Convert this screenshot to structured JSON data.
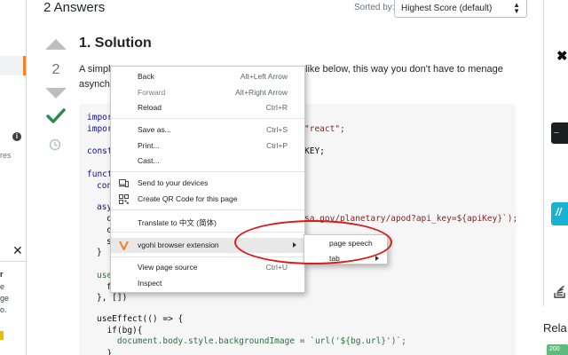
{
  "header": {
    "answers_count": "2 Answers",
    "sort_label": "Sorted by:",
    "sort_value": "Highest Score (default)"
  },
  "vote": {
    "count": "2"
  },
  "answer": {
    "title": "1. Solution",
    "p1": "A simpl",
    "p2": "like below, this way you don't have to menage",
    "p3": "asynchr",
    "code": [
      {
        "text": "impor",
        "kind": "kw"
      },
      {
        "text": "impor",
        "kind": "kw"
      },
      {
        "text": "\"react\";",
        "kind": "str"
      },
      {
        "text": "const",
        "kind": "kw"
      },
      {
        "text": "KEY;",
        "kind": "plain"
      },
      {
        "text": "funct",
        "kind": "kw"
      },
      {
        "text": "con",
        "kind": "kw"
      },
      {
        "text": "asy",
        "kind": "kw"
      },
      {
        "text": "c",
        "kind": "plain"
      },
      {
        "text": "sa.gov/planetary/apod?api_key=${apiKey}`);",
        "kind": "str"
      },
      {
        "text": "c",
        "kind": "plain"
      },
      {
        "text": "s",
        "kind": "plain"
      },
      {
        "text": "}",
        "kind": "plain"
      },
      {
        "text": "use",
        "kind": "fn"
      },
      {
        "text": "f",
        "kind": "plain"
      },
      {
        "text": "}, [])",
        "kind": "plain"
      },
      {
        "text": "useEffect(() => {",
        "kind": "plain"
      },
      {
        "text": "  if(bg){",
        "kind": "plain"
      },
      {
        "text": "    document.body.style.backgroundImage = `url('${bg.url}')`;",
        "kind": "plain"
      },
      {
        "text": "  }",
        "kind": "plain"
      }
    ]
  },
  "left_gutter": {
    "info": "i",
    "res": "res",
    "close": "✕",
    "r": "r",
    "e": "e",
    "ge": "ge",
    "o": "o."
  },
  "right_sidebar": {
    "x": "✖",
    "dark_text": "-----",
    "cyan_text": "//",
    "related": "Rela",
    "badge": "200"
  },
  "context_menu": {
    "items": [
      {
        "label": "Back",
        "shortcut": "Alt+Left Arrow",
        "disabled": false
      },
      {
        "label": "Forward",
        "shortcut": "Alt+Right Arrow",
        "disabled": true
      },
      {
        "label": "Reload",
        "shortcut": "Ctrl+R",
        "disabled": false
      },
      {
        "label": "Save as...",
        "shortcut": "Ctrl+S",
        "disabled": false
      },
      {
        "label": "Print...",
        "shortcut": "Ctrl+P",
        "disabled": false
      },
      {
        "label": "Cast...",
        "shortcut": "",
        "disabled": false
      },
      {
        "label": "Send to your devices",
        "shortcut": "",
        "disabled": false,
        "icon": "device-icon"
      },
      {
        "label": "Create QR Code for this page",
        "shortcut": "",
        "disabled": false,
        "icon": "qr-code-icon"
      },
      {
        "label": "Translate to 中文 (简体)",
        "shortcut": "",
        "disabled": false
      },
      {
        "label": "vgohi browser extension",
        "shortcut": "",
        "disabled": false,
        "icon": "extension-v-icon",
        "submenu": true
      },
      {
        "label": "View page source",
        "shortcut": "Ctrl+U",
        "disabled": false
      },
      {
        "label": "Inspect",
        "shortcut": "",
        "disabled": false
      }
    ]
  },
  "submenu": {
    "items": [
      {
        "label": "page speech",
        "submenu": false
      },
      {
        "label": "tab",
        "submenu": true
      }
    ]
  },
  "colors": {
    "accent_orange": "#f48225",
    "accepted_green": "#2f8a52",
    "annotation_red": "#d81b1b"
  }
}
